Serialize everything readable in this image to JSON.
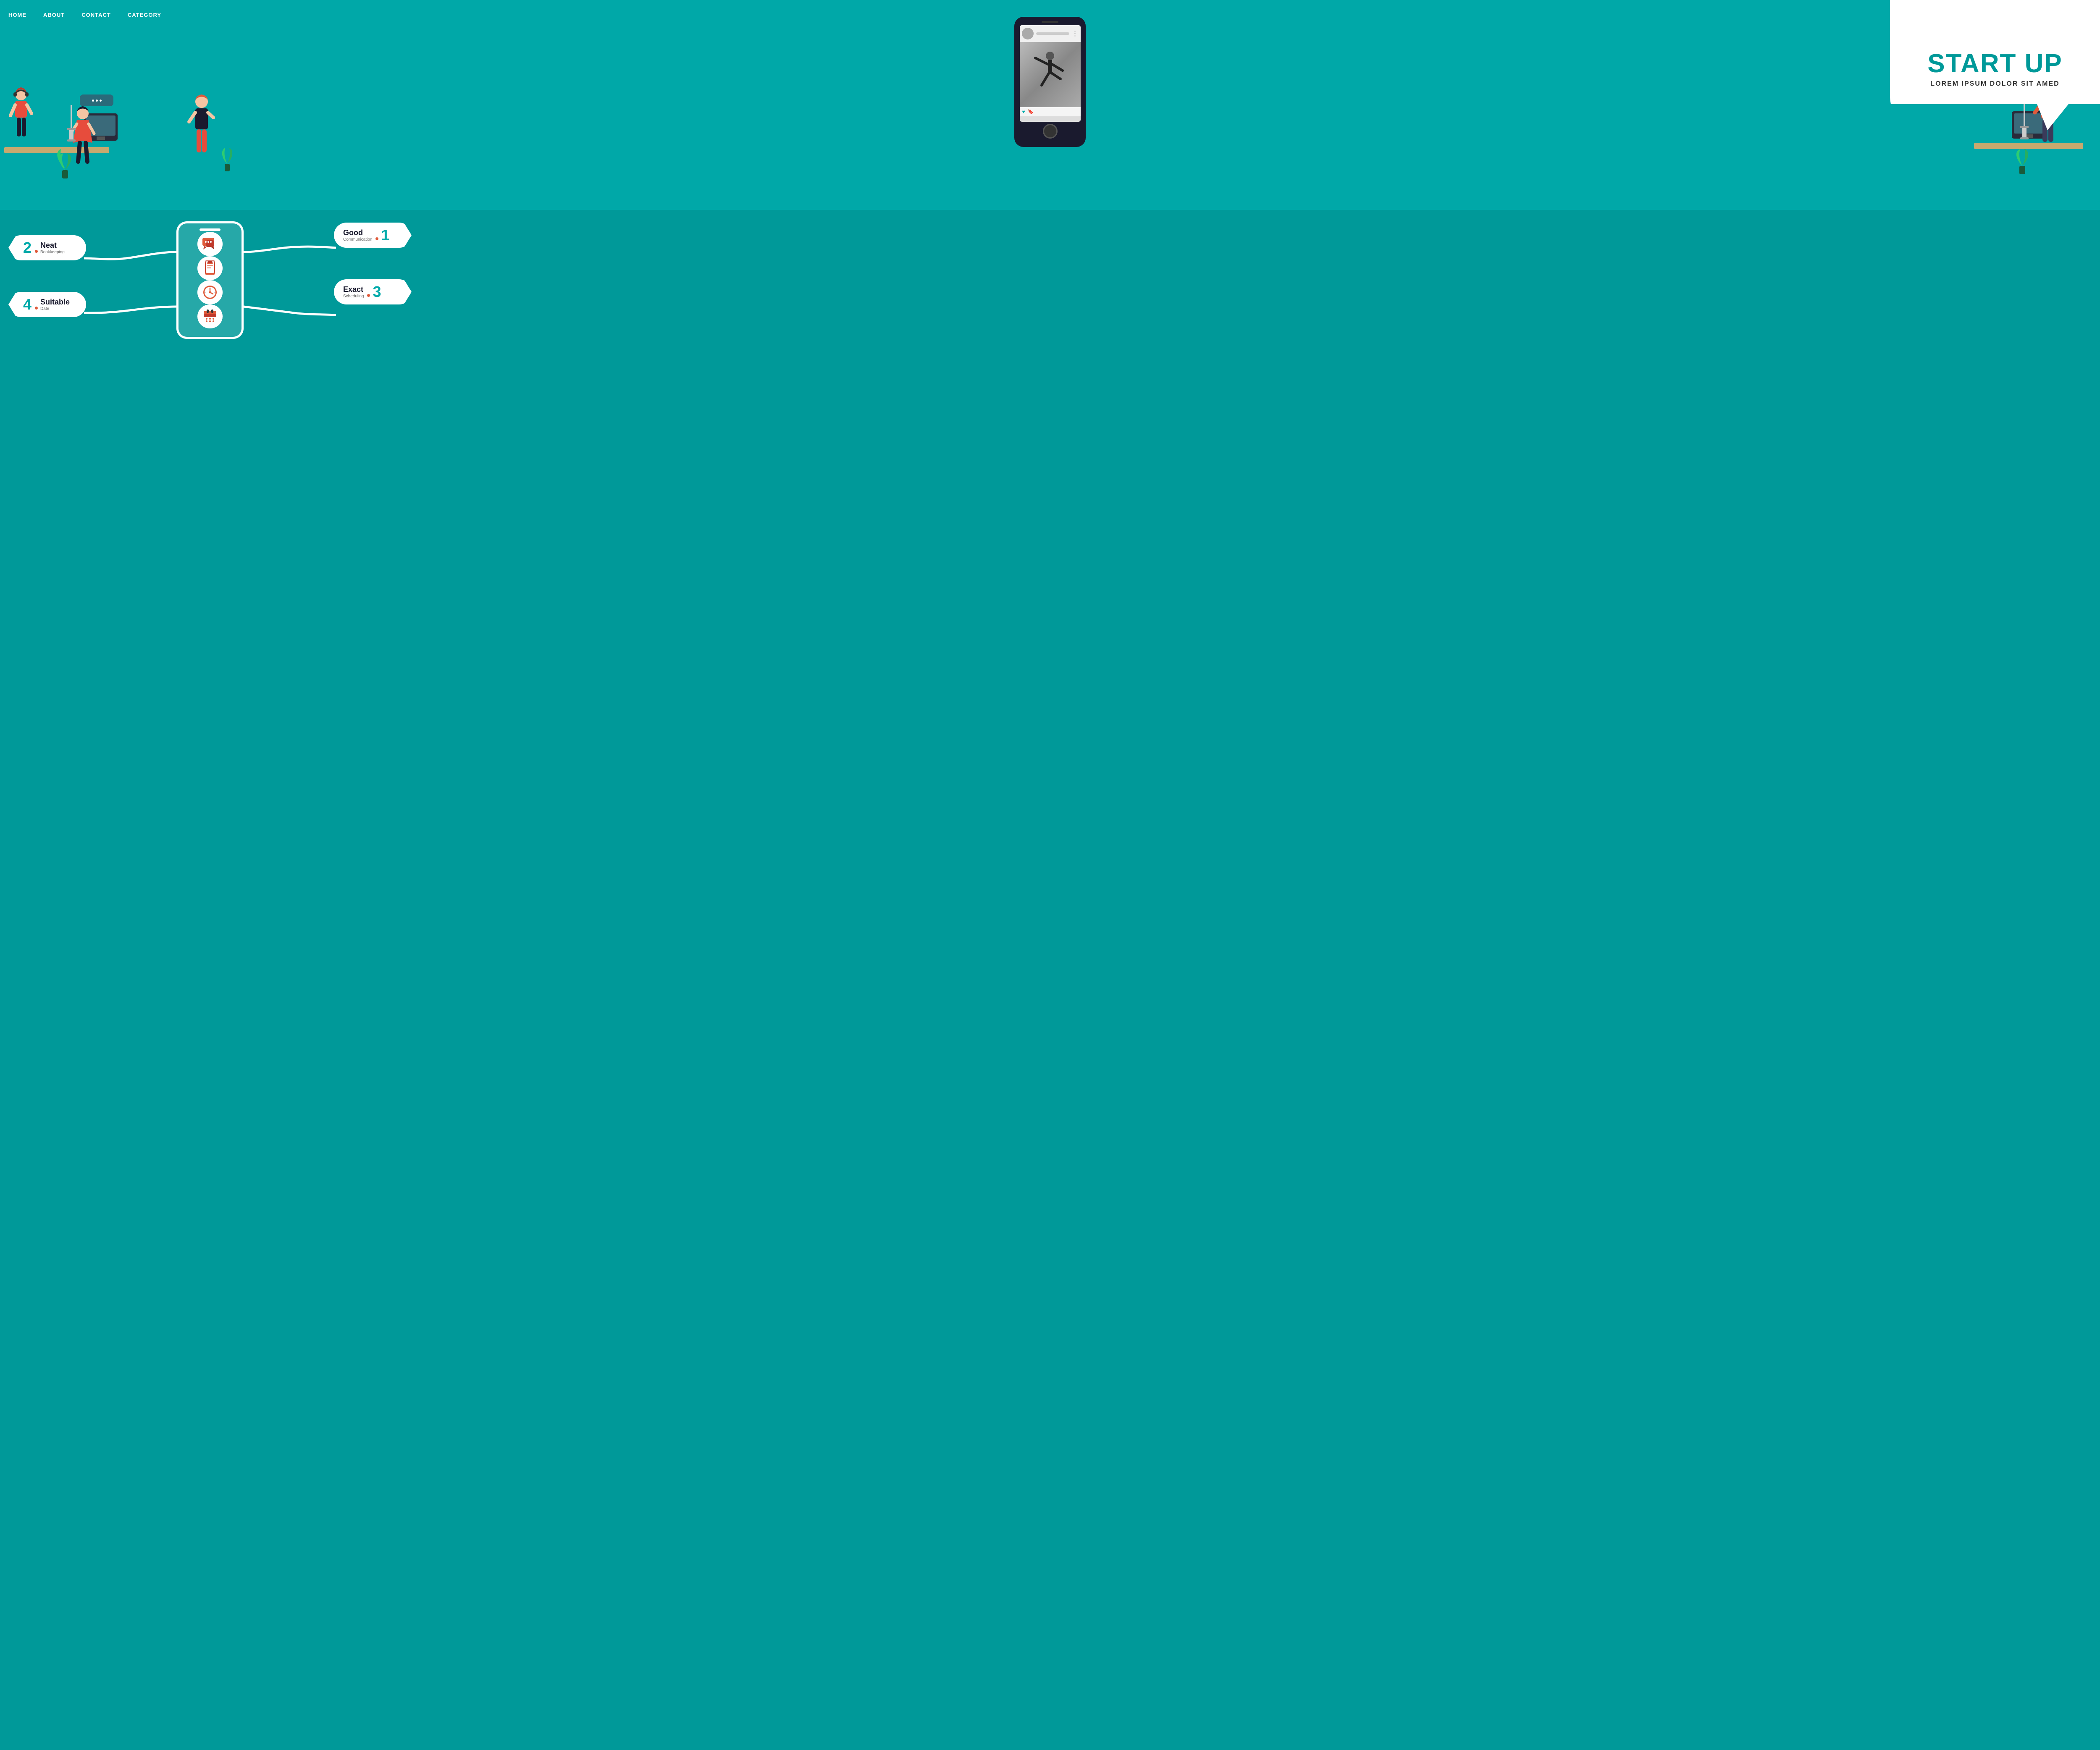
{
  "nav": {
    "items": [
      {
        "label": "HOME",
        "id": "home"
      },
      {
        "label": "ABOUT",
        "id": "about"
      },
      {
        "label": "CONTACT",
        "id": "contact"
      },
      {
        "label": "CATEGORY",
        "id": "category"
      }
    ]
  },
  "hero": {
    "title": "START UP",
    "subtitle": "LOREM IPSUM DOLOR SIT AMED"
  },
  "infographic": {
    "items": [
      {
        "number": "1",
        "main": "Good",
        "sub_main": "Communication",
        "position": "right-top"
      },
      {
        "number": "2",
        "main": "Neat",
        "sub_main": "Bookkeeping",
        "position": "left-top"
      },
      {
        "number": "3",
        "main": "Exact",
        "sub_main": "Scheduling",
        "position": "right-bottom"
      },
      {
        "number": "4",
        "main": "Suitable",
        "sub_main": "Date",
        "position": "left-bottom"
      }
    ],
    "icons": [
      "💬",
      "📋",
      "🕐",
      "📅"
    ]
  },
  "colors": {
    "teal": "#009999",
    "dark_teal": "#007777",
    "accent_red": "#e05a3a",
    "white": "#ffffff",
    "dark": "#1a1a2e"
  }
}
